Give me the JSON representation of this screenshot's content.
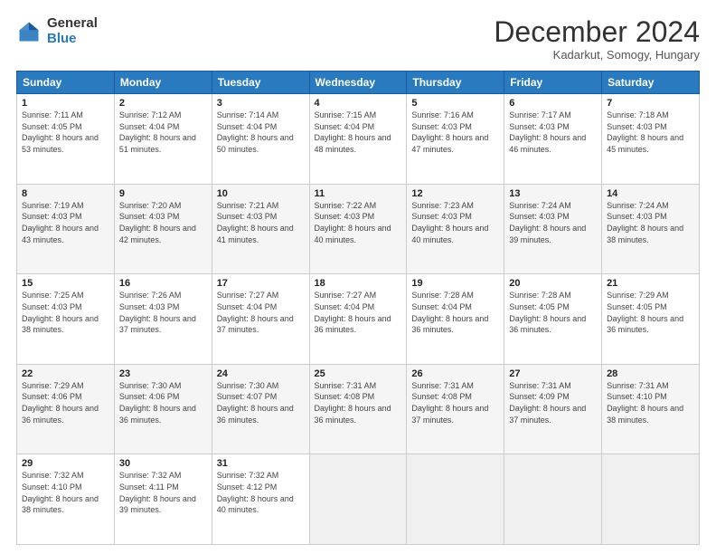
{
  "header": {
    "logo_general": "General",
    "logo_blue": "Blue",
    "month_title": "December 2024",
    "location": "Kadarkut, Somogy, Hungary"
  },
  "days_of_week": [
    "Sunday",
    "Monday",
    "Tuesday",
    "Wednesday",
    "Thursday",
    "Friday",
    "Saturday"
  ],
  "weeks": [
    [
      {
        "day": "1",
        "sunrise": "Sunrise: 7:11 AM",
        "sunset": "Sunset: 4:05 PM",
        "daylight": "Daylight: 8 hours and 53 minutes."
      },
      {
        "day": "2",
        "sunrise": "Sunrise: 7:12 AM",
        "sunset": "Sunset: 4:04 PM",
        "daylight": "Daylight: 8 hours and 51 minutes."
      },
      {
        "day": "3",
        "sunrise": "Sunrise: 7:14 AM",
        "sunset": "Sunset: 4:04 PM",
        "daylight": "Daylight: 8 hours and 50 minutes."
      },
      {
        "day": "4",
        "sunrise": "Sunrise: 7:15 AM",
        "sunset": "Sunset: 4:04 PM",
        "daylight": "Daylight: 8 hours and 48 minutes."
      },
      {
        "day": "5",
        "sunrise": "Sunrise: 7:16 AM",
        "sunset": "Sunset: 4:03 PM",
        "daylight": "Daylight: 8 hours and 47 minutes."
      },
      {
        "day": "6",
        "sunrise": "Sunrise: 7:17 AM",
        "sunset": "Sunset: 4:03 PM",
        "daylight": "Daylight: 8 hours and 46 minutes."
      },
      {
        "day": "7",
        "sunrise": "Sunrise: 7:18 AM",
        "sunset": "Sunset: 4:03 PM",
        "daylight": "Daylight: 8 hours and 45 minutes."
      }
    ],
    [
      {
        "day": "8",
        "sunrise": "Sunrise: 7:19 AM",
        "sunset": "Sunset: 4:03 PM",
        "daylight": "Daylight: 8 hours and 43 minutes."
      },
      {
        "day": "9",
        "sunrise": "Sunrise: 7:20 AM",
        "sunset": "Sunset: 4:03 PM",
        "daylight": "Daylight: 8 hours and 42 minutes."
      },
      {
        "day": "10",
        "sunrise": "Sunrise: 7:21 AM",
        "sunset": "Sunset: 4:03 PM",
        "daylight": "Daylight: 8 hours and 41 minutes."
      },
      {
        "day": "11",
        "sunrise": "Sunrise: 7:22 AM",
        "sunset": "Sunset: 4:03 PM",
        "daylight": "Daylight: 8 hours and 40 minutes."
      },
      {
        "day": "12",
        "sunrise": "Sunrise: 7:23 AM",
        "sunset": "Sunset: 4:03 PM",
        "daylight": "Daylight: 8 hours and 40 minutes."
      },
      {
        "day": "13",
        "sunrise": "Sunrise: 7:24 AM",
        "sunset": "Sunset: 4:03 PM",
        "daylight": "Daylight: 8 hours and 39 minutes."
      },
      {
        "day": "14",
        "sunrise": "Sunrise: 7:24 AM",
        "sunset": "Sunset: 4:03 PM",
        "daylight": "Daylight: 8 hours and 38 minutes."
      }
    ],
    [
      {
        "day": "15",
        "sunrise": "Sunrise: 7:25 AM",
        "sunset": "Sunset: 4:03 PM",
        "daylight": "Daylight: 8 hours and 38 minutes."
      },
      {
        "day": "16",
        "sunrise": "Sunrise: 7:26 AM",
        "sunset": "Sunset: 4:03 PM",
        "daylight": "Daylight: 8 hours and 37 minutes."
      },
      {
        "day": "17",
        "sunrise": "Sunrise: 7:27 AM",
        "sunset": "Sunset: 4:04 PM",
        "daylight": "Daylight: 8 hours and 37 minutes."
      },
      {
        "day": "18",
        "sunrise": "Sunrise: 7:27 AM",
        "sunset": "Sunset: 4:04 PM",
        "daylight": "Daylight: 8 hours and 36 minutes."
      },
      {
        "day": "19",
        "sunrise": "Sunrise: 7:28 AM",
        "sunset": "Sunset: 4:04 PM",
        "daylight": "Daylight: 8 hours and 36 minutes."
      },
      {
        "day": "20",
        "sunrise": "Sunrise: 7:28 AM",
        "sunset": "Sunset: 4:05 PM",
        "daylight": "Daylight: 8 hours and 36 minutes."
      },
      {
        "day": "21",
        "sunrise": "Sunrise: 7:29 AM",
        "sunset": "Sunset: 4:05 PM",
        "daylight": "Daylight: 8 hours and 36 minutes."
      }
    ],
    [
      {
        "day": "22",
        "sunrise": "Sunrise: 7:29 AM",
        "sunset": "Sunset: 4:06 PM",
        "daylight": "Daylight: 8 hours and 36 minutes."
      },
      {
        "day": "23",
        "sunrise": "Sunrise: 7:30 AM",
        "sunset": "Sunset: 4:06 PM",
        "daylight": "Daylight: 8 hours and 36 minutes."
      },
      {
        "day": "24",
        "sunrise": "Sunrise: 7:30 AM",
        "sunset": "Sunset: 4:07 PM",
        "daylight": "Daylight: 8 hours and 36 minutes."
      },
      {
        "day": "25",
        "sunrise": "Sunrise: 7:31 AM",
        "sunset": "Sunset: 4:08 PM",
        "daylight": "Daylight: 8 hours and 36 minutes."
      },
      {
        "day": "26",
        "sunrise": "Sunrise: 7:31 AM",
        "sunset": "Sunset: 4:08 PM",
        "daylight": "Daylight: 8 hours and 37 minutes."
      },
      {
        "day": "27",
        "sunrise": "Sunrise: 7:31 AM",
        "sunset": "Sunset: 4:09 PM",
        "daylight": "Daylight: 8 hours and 37 minutes."
      },
      {
        "day": "28",
        "sunrise": "Sunrise: 7:31 AM",
        "sunset": "Sunset: 4:10 PM",
        "daylight": "Daylight: 8 hours and 38 minutes."
      }
    ],
    [
      {
        "day": "29",
        "sunrise": "Sunrise: 7:32 AM",
        "sunset": "Sunset: 4:10 PM",
        "daylight": "Daylight: 8 hours and 38 minutes."
      },
      {
        "day": "30",
        "sunrise": "Sunrise: 7:32 AM",
        "sunset": "Sunset: 4:11 PM",
        "daylight": "Daylight: 8 hours and 39 minutes."
      },
      {
        "day": "31",
        "sunrise": "Sunrise: 7:32 AM",
        "sunset": "Sunset: 4:12 PM",
        "daylight": "Daylight: 8 hours and 40 minutes."
      },
      null,
      null,
      null,
      null
    ]
  ]
}
